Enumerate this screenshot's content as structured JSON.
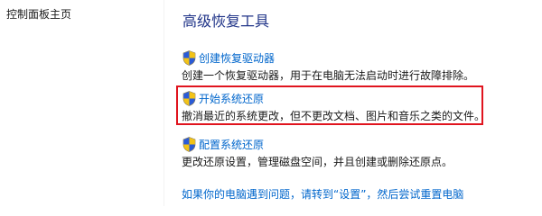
{
  "sidebar": {
    "home_label": "控制面板主页"
  },
  "main": {
    "title": "高级恢复工具",
    "tools": [
      {
        "label": "创建恢复驱动器",
        "icon": "uac-shield-icon",
        "description": "创建一个恢复驱动器，用于在电脑无法启动时进行故障排除。"
      },
      {
        "label": "开始系统还原",
        "icon": "uac-shield-icon",
        "description": "撤消最近的系统更改，但不更改文档、图片和音乐之类的文件。"
      },
      {
        "label": "配置系统还原",
        "icon": "uac-shield-icon",
        "description": "更改还原设置，管理磁盘空间，并且创建或删除还原点。"
      }
    ],
    "bottom_link": "如果你的电脑遇到问题，请转到“设置”，然后尝试重置电脑"
  },
  "colors": {
    "title": "#1e3287",
    "link": "#0066cc",
    "highlight_border": "#e0141e",
    "text": "#1a1a1a"
  }
}
